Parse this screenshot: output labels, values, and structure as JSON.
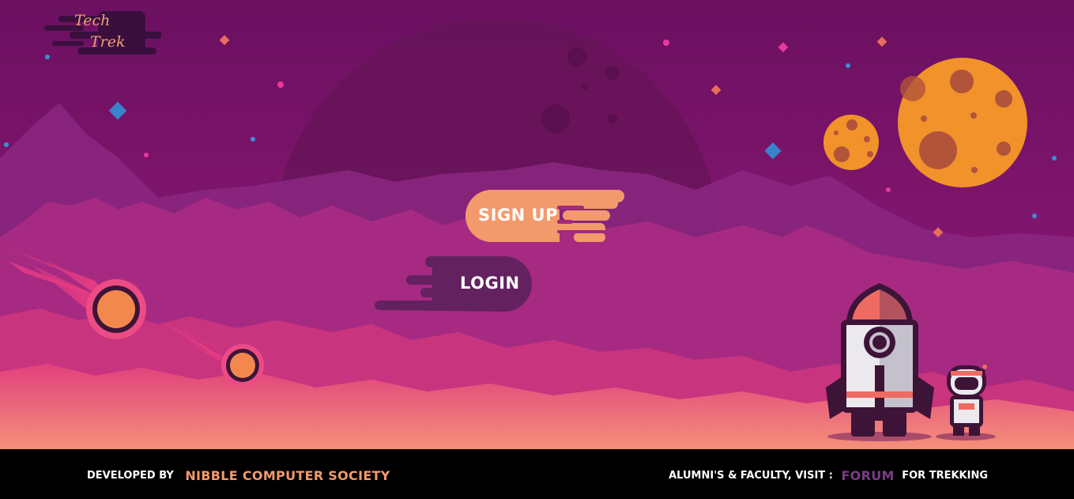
{
  "logo": {
    "line1": "Tech",
    "line2": "Trek"
  },
  "buttons": {
    "signup": "SIGN UP",
    "login": "LOGIN"
  },
  "footer": {
    "developed_by": "DEVELOPED BY",
    "society": "NIBBLE COMPUTER SOCIETY",
    "alumni_text": "ALUMNI'S & FACULTY, VISIT :",
    "forum_link": "FORUM",
    "trekking_text": "FOR TREKKING"
  },
  "colors": {
    "sky_top": "#6b1060",
    "sky_bottom": "#8e1f7e",
    "accent_orange": "#f39a6d",
    "login_purple": "#63215f",
    "footer_bg": "#000000",
    "forum_purple": "#7c3c88"
  }
}
